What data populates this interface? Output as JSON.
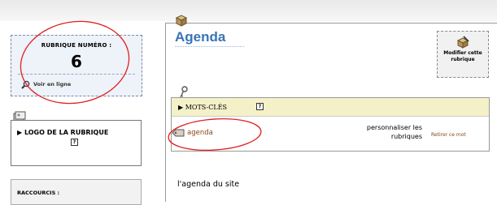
{
  "left": {
    "rubrique_label": "RUBRIQUE NUMÉRO :",
    "rubrique_number": "6",
    "voir_en_ligne": "Voir en ligne",
    "logo_title": "▶ LOGO DE LA RUBRIQUE",
    "raccourcis": "RACCOURCIS :"
  },
  "main": {
    "title": "Agenda",
    "modify_label": "Modifier cette rubrique",
    "mots_cles_title": "▶ MOTS-CLÉS",
    "keyword": "agenda",
    "personnaliser": "personnaliser les rubriques",
    "retirer": "Retirer ce mot",
    "description": "l'agenda du site"
  },
  "help_glyph": "?",
  "colors": {
    "title_blue": "#3874b7",
    "keyword_brown": "#8b4513",
    "annotation_red": "#e02020",
    "mots_cles_bg": "#f4f1c9",
    "rubrique_bg": "#eef2f9"
  },
  "icons": [
    "box-icon",
    "magnifier-icon",
    "logo-image-icon",
    "key-icon",
    "pencil-box-icon",
    "keyword-tag-icon",
    "help-icon"
  ]
}
